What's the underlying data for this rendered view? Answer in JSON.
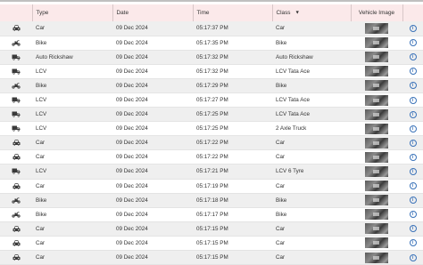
{
  "header": {
    "type": "Type",
    "date": "Date",
    "time": "Time",
    "class": "Class",
    "image": "Vehicle Image"
  },
  "rows": [
    {
      "icon": "car-icon",
      "type": "Car",
      "date": "09 Dec 2024",
      "time": "05:17:37 PM",
      "class": "Car"
    },
    {
      "icon": "bike-icon",
      "type": "Bike",
      "date": "09 Dec 2024",
      "time": "05:17:35 PM",
      "class": "Bike"
    },
    {
      "icon": "truck-icon",
      "type": "Auto Rickshaw",
      "date": "09 Dec 2024",
      "time": "05:17:32 PM",
      "class": "Auto Rickshaw"
    },
    {
      "icon": "truck-icon",
      "type": "LCV",
      "date": "09 Dec 2024",
      "time": "05:17:32 PM",
      "class": "LCV Tata Ace"
    },
    {
      "icon": "bike-icon",
      "type": "Bike",
      "date": "09 Dec 2024",
      "time": "05:17:29 PM",
      "class": "Bike"
    },
    {
      "icon": "truck-icon",
      "type": "LCV",
      "date": "09 Dec 2024",
      "time": "05:17:27 PM",
      "class": "LCV Tata Ace"
    },
    {
      "icon": "truck-icon",
      "type": "LCV",
      "date": "09 Dec 2024",
      "time": "05:17:25 PM",
      "class": "LCV Tata Ace"
    },
    {
      "icon": "truck-icon",
      "type": "LCV",
      "date": "09 Dec 2024",
      "time": "05:17:25 PM",
      "class": "2 Axle Truck"
    },
    {
      "icon": "car-icon",
      "type": "Car",
      "date": "09 Dec 2024",
      "time": "05:17:22 PM",
      "class": "Car"
    },
    {
      "icon": "car-icon",
      "type": "Car",
      "date": "09 Dec 2024",
      "time": "05:17:22 PM",
      "class": "Car"
    },
    {
      "icon": "truck-icon",
      "type": "LCV",
      "date": "09 Dec 2024",
      "time": "05:17:21 PM",
      "class": "LCV 6 Tyre"
    },
    {
      "icon": "car-icon",
      "type": "Car",
      "date": "09 Dec 2024",
      "time": "05:17:19 PM",
      "class": "Car"
    },
    {
      "icon": "bike-icon",
      "type": "Bike",
      "date": "09 Dec 2024",
      "time": "05:17:18 PM",
      "class": "Bike"
    },
    {
      "icon": "bike-icon",
      "type": "Bike",
      "date": "09 Dec 2024",
      "time": "05:17:17 PM",
      "class": "Bike"
    },
    {
      "icon": "car-icon",
      "type": "Car",
      "date": "09 Dec 2024",
      "time": "05:17:15 PM",
      "class": "Car"
    },
    {
      "icon": "car-icon",
      "type": "Car",
      "date": "09 Dec 2024",
      "time": "05:17:15 PM",
      "class": "Car"
    },
    {
      "icon": "car-icon",
      "type": "Car",
      "date": "09 Dec 2024",
      "time": "05:17:15 PM",
      "class": "Car"
    }
  ],
  "icons": {
    "sort": "sort-descending-icon",
    "info": "info-icon",
    "thumbnail": "vehicle-thumbnail-image"
  },
  "colors": {
    "header_bg": "#fbe9ea",
    "alt_row_bg": "#efefef",
    "info_icon": "#3b73b9"
  }
}
